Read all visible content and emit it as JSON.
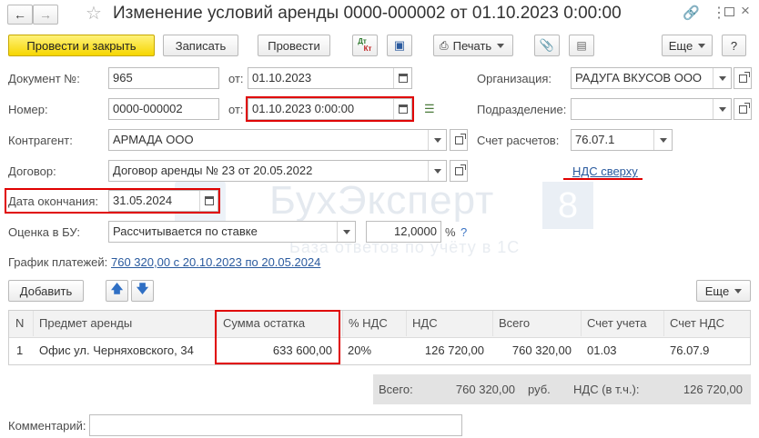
{
  "window": {
    "title": "Изменение условий аренды 0000-000002 от 01.10.2023 0:00:00"
  },
  "toolbar": {
    "post_close": "Провести и закрыть",
    "save": "Записать",
    "post": "Провести",
    "dtkt_dt": "Дт",
    "dtkt_kt": "Кт",
    "print": "Печать",
    "more": "Еще",
    "help": "?"
  },
  "form": {
    "doc_no_label": "Документ №:",
    "doc_no_value": "965",
    "from_label": "от:",
    "doc_date": "01.10.2023",
    "number_label": "Номер:",
    "number_value": "0000-000002",
    "number_from_label": "от:",
    "number_datetime": "01.10.2023  0:00:00",
    "org_label": "Организация:",
    "org_value": "РАДУГА ВКУСОВ ООО",
    "dept_label": "Подразделение:",
    "dept_value": "",
    "contractor_label": "Контрагент:",
    "contractor_value": "АРМАДА ООО",
    "account_label": "Счет расчетов:",
    "account_value": "76.07.1",
    "contract_label": "Договор:",
    "contract_value": "Договор аренды № 23 от 20.05.2022",
    "vat_link": "НДС сверху",
    "end_date_label": "Дата окончания:",
    "end_date_value": "31.05.2024",
    "valuation_label": "Оценка в БУ:",
    "valuation_value": "Рассчитывается по ставке",
    "rate_value": "12,0000",
    "rate_unit": "%",
    "rate_help": "?",
    "schedule_label": "График платежей:",
    "schedule_link": "760 320,00 с 20.10.2023 по 20.05.2024"
  },
  "table_toolbar": {
    "add": "Добавить",
    "more": "Еще"
  },
  "table": {
    "columns": [
      "N",
      "Предмет аренды",
      "Сумма остатка",
      "% НДС",
      "НДС",
      "Всего",
      "Счет учета",
      "Счет НДС"
    ],
    "rows": [
      {
        "n": "1",
        "item": "Офис ул. Черняховского, 34",
        "balance": "633 600,00",
        "vat_rate": "20%",
        "vat": "126 720,00",
        "total": "760 320,00",
        "account": "01.03",
        "vat_account": "76.07.9"
      }
    ]
  },
  "totals": {
    "total_label": "Всего:",
    "total_value": "760 320,00",
    "currency": "руб.",
    "vat_label": "НДС (в т.ч.):",
    "vat_value": "126 720,00"
  },
  "comment": {
    "label": "Комментарий:",
    "value": ""
  },
  "watermark": {
    "brand": "БухЭксперт",
    "badge": "8",
    "subtitle": "База ответов по учёту в 1С"
  },
  "colors": {
    "primary_button": "#f6d600",
    "highlight_border": "#e00000",
    "link": "#2a5a9e"
  }
}
